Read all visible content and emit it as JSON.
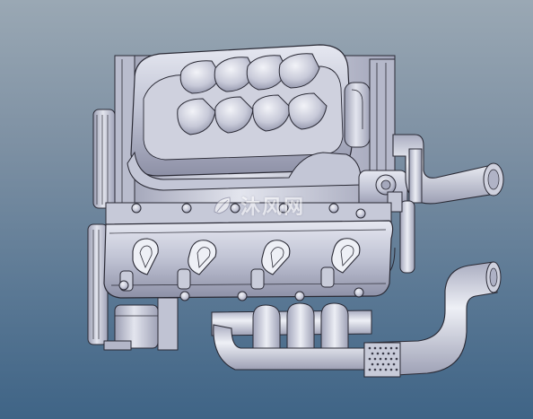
{
  "scene": {
    "subject": "engine-cad-model",
    "render_style": "shaded wireframe CAD",
    "colors": {
      "background_top": "#9aa8b4",
      "background_bottom": "#3f6486",
      "metal_light": "#d9dbe6",
      "metal_mid": "#b3b6c8",
      "metal_dark": "#8a8da3",
      "edge_line": "#2a2a35"
    }
  },
  "watermark": {
    "text": "沐风网",
    "logo_icon": "leaf-logo-icon"
  }
}
